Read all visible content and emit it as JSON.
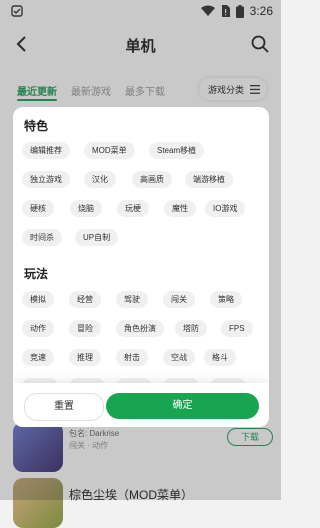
{
  "status_bar": {
    "time": "3:26"
  },
  "header": {
    "title": "单机"
  },
  "tabs": [
    {
      "label": "最近更新"
    },
    {
      "label": "最新游戏"
    },
    {
      "label": "最多下载"
    }
  ],
  "filter_button": {
    "label": "游戏分类"
  },
  "list": {
    "row1": {
      "meta1": "包名: Darkrise",
      "meta2": "闯关 · 动作",
      "download": "下载"
    },
    "row2": {
      "name": "棕色尘埃（MOD菜单）"
    }
  },
  "panel": {
    "features": {
      "title": "特色",
      "chips": [
        "编辑推荐",
        "MOD菜单",
        "Steam移植",
        "独立游戏",
        "汉化",
        "高画质",
        "端游移植",
        "硬核",
        "烧脑",
        "玩梗",
        "魔性",
        "IO游戏",
        "时间杀",
        "UP自制"
      ]
    },
    "gameplay": {
      "title": "玩法",
      "chips": [
        "模拟",
        "经营",
        "驾驶",
        "闯关",
        "策略",
        "动作",
        "冒险",
        "角色扮演",
        "塔防",
        "FPS",
        "竞速",
        "推理",
        "射击",
        "空战",
        "格斗"
      ]
    },
    "reset_label": "重置",
    "confirm_label": "确定"
  },
  "colors": {
    "accent": "#18a551",
    "tab_active": "#1a9f5b"
  }
}
